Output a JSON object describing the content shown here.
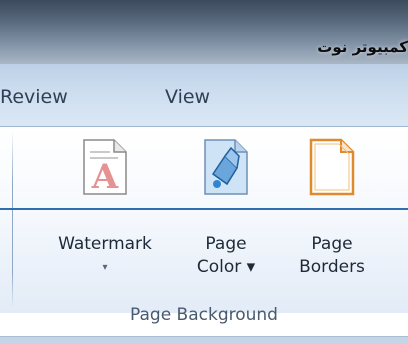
{
  "window": {
    "title": "كمبيوتر نوت"
  },
  "tabs": [
    {
      "label": "Review"
    },
    {
      "label": "View"
    }
  ],
  "ribbon": {
    "group_label": "Page Background",
    "buttons": [
      {
        "line1": "Watermark",
        "line2": "▾",
        "icon": "watermark-icon"
      },
      {
        "line1": "Page",
        "line2": "Color ▾",
        "icon": "page-color-icon"
      },
      {
        "line1": "Page",
        "line2": "Borders",
        "icon": "page-borders-icon"
      }
    ]
  },
  "colors": {
    "accent_line": "#2f6fb0",
    "watermark_red": "#d04a4a",
    "paint_blue": "#2f86d0",
    "border_orange": "#e08a2e"
  }
}
